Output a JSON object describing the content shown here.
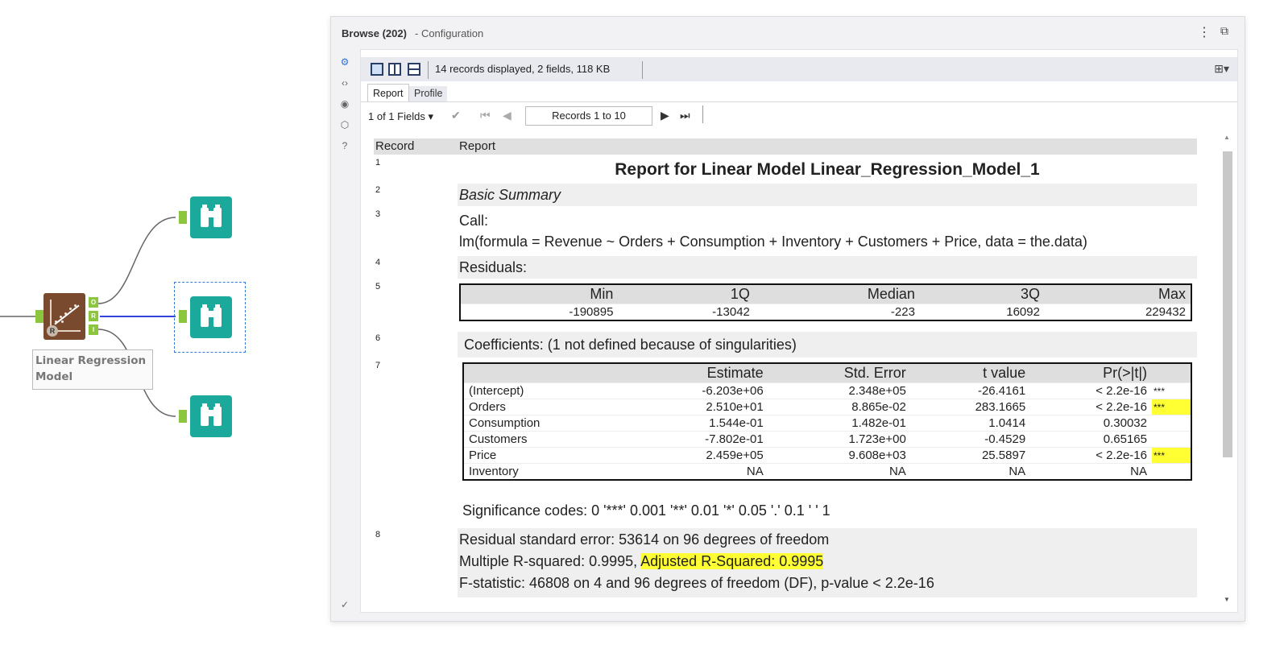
{
  "workflow": {
    "tool_label": "Linear Regression Model",
    "anchors": [
      "O",
      "R",
      "I"
    ]
  },
  "panel": {
    "title": "Browse (202)",
    "subtitle": "- Configuration",
    "records_info": "14 records displayed, 2 fields, 118 KB",
    "tabs": [
      "Report",
      "Profile"
    ],
    "fields_selector": "1 of 1 Fields",
    "records_range": "Records 1 to 10"
  },
  "report": {
    "headers": {
      "record": "Record",
      "report": "Report"
    },
    "rows": {
      "r1": {
        "num": "1",
        "text": "Report for Linear Model Linear_Regression_Model_1"
      },
      "r2": {
        "num": "2",
        "text": "Basic Summary"
      },
      "r3": {
        "num": "3",
        "line1": "Call:",
        "line2": "lm(formula = Revenue ~ Orders + Consumption + Inventory + Customers + Price, data = the.data)"
      },
      "r4": {
        "num": "4",
        "text": "Residuals:"
      },
      "r5": {
        "num": "5"
      },
      "r6": {
        "num": "6",
        "text": "Coefficients: (1 not defined because of singularities)"
      },
      "r7": {
        "num": "7",
        "significance": "Significance codes: 0 '***' 0.001 '**' 0.01 '*' 0.05 '.' 0.1 ' ' 1"
      },
      "r8": {
        "num": "8",
        "line1": "Residual standard error: 53614 on 96 degrees of freedom",
        "line2a": "Multiple R-squared: 0.9995, ",
        "line2b": "Adjusted R-Squared: 0.9995",
        "line3": "F-statistic: 46808 on 4 and 96 degrees of freedom (DF), p-value < 2.2e-16"
      }
    },
    "residuals": {
      "headers": [
        "Min",
        "1Q",
        "Median",
        "3Q",
        "Max"
      ],
      "values": [
        "-190895",
        "-13042",
        "-223",
        "16092",
        "229432"
      ]
    },
    "coefficients": {
      "headers": [
        "",
        "Estimate",
        "Std. Error",
        "t value",
        "Pr(>|t|)",
        ""
      ],
      "rows": [
        [
          "(Intercept)",
          "-6.203e+06",
          "2.348e+05",
          "-26.4161",
          "< 2.2e-16",
          "***"
        ],
        [
          "Orders",
          "2.510e+01",
          "8.865e-02",
          "283.1665",
          "< 2.2e-16",
          "***"
        ],
        [
          "Consumption",
          "1.544e-01",
          "1.482e-01",
          "1.0414",
          "0.30032",
          ""
        ],
        [
          "Customers",
          "-7.802e-01",
          "1.723e+00",
          "-0.4529",
          "0.65165",
          ""
        ],
        [
          "Price",
          "2.459e+05",
          "9.608e+03",
          "25.5897",
          "< 2.2e-16",
          "***"
        ],
        [
          "Inventory",
          "NA",
          "NA",
          "NA",
          "NA",
          ""
        ]
      ],
      "highlighted_stars_rows": [
        1,
        4
      ]
    }
  }
}
